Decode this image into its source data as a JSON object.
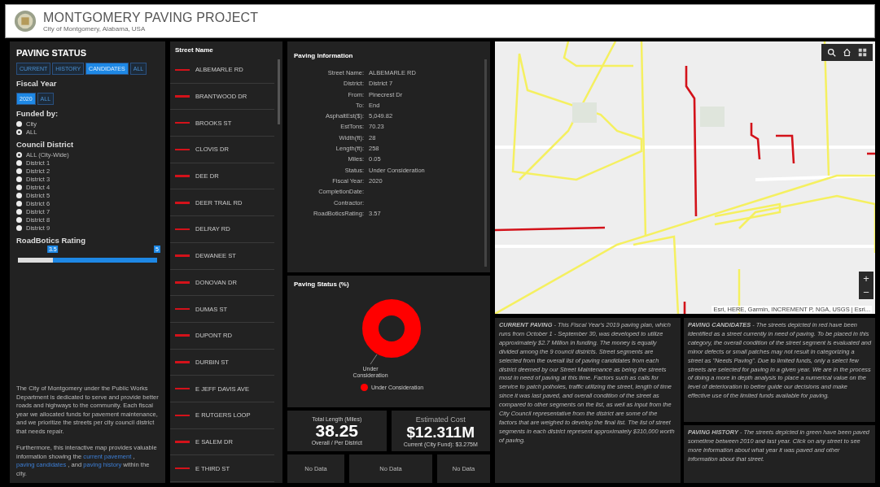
{
  "header": {
    "title": "MONTGOMERY PAVING PROJECT",
    "subtitle": "City of Montgomery, Alabama, USA"
  },
  "paving_status": {
    "title": "PAVING STATUS",
    "tabs": [
      {
        "label": "CURRENT",
        "selected": false
      },
      {
        "label": "HISTORY",
        "selected": false
      },
      {
        "label": "CANDIDATES",
        "selected": true
      },
      {
        "label": "ALL",
        "selected": false
      }
    ],
    "fiscal_year": {
      "label": "Fiscal Year",
      "options": [
        {
          "label": "2020",
          "selected": true
        },
        {
          "label": "ALL",
          "selected": false
        }
      ]
    },
    "funded_by": {
      "label": "Funded by:",
      "options": [
        {
          "label": "City",
          "selected": false
        },
        {
          "label": "ALL",
          "selected": true
        }
      ]
    },
    "council_district": {
      "label": "Council District",
      "options": [
        {
          "label": "ALL (City-Wide)",
          "selected": true
        },
        {
          "label": "District 1",
          "selected": false
        },
        {
          "label": "District 2",
          "selected": false
        },
        {
          "label": "District 3",
          "selected": false
        },
        {
          "label": "District 4",
          "selected": false
        },
        {
          "label": "District 5",
          "selected": false
        },
        {
          "label": "District 6",
          "selected": false
        },
        {
          "label": "District 7",
          "selected": false
        },
        {
          "label": "District 8",
          "selected": false
        },
        {
          "label": "District 9",
          "selected": false
        }
      ]
    },
    "rating": {
      "label": "RoadBotics Rating",
      "low_label": "3.5",
      "high_label": "5",
      "level": 0.75
    },
    "intro": "The City of Montgomery under the Public Works Department is dedicated to serve and provide better roads and highways to the community. Each fiscal year we allocated funds for pavement maintenance, and we prioritize the streets per city council district that needs repair.",
    "more": [
      {
        "kind": "text",
        "text": "Furthermore, this interactive map provides valuable information showing the"
      },
      {
        "kind": "link",
        "text": "current pavement"
      },
      {
        "kind": "text",
        "text": ","
      },
      {
        "kind": "link",
        "text": "paving candidates"
      },
      {
        "kind": "text",
        "text": ", and"
      },
      {
        "kind": "link",
        "text": "paving history"
      },
      {
        "kind": "text",
        "text": "within the city."
      }
    ]
  },
  "street_list": {
    "title": "Street Name",
    "items": [
      "ALBEMARLE RD",
      "BRANTWOOD DR",
      "BROOKS ST",
      "CLOVIS DR",
      "DEE DR",
      "DEER TRAIL RD",
      "DELRAY RD",
      "DEWANEE ST",
      "DONOVAN DR",
      "DUMAS ST",
      "DUPONT RD",
      "DURBIN ST",
      "E JEFF DAVIS AVE",
      "E RUTGERS LOOP",
      "E SALEM DR",
      "E THIRD ST"
    ]
  },
  "paving_information": {
    "title": "Paving Information",
    "fields": [
      {
        "label": "Street Name:",
        "value": "ALBEMARLE RD"
      },
      {
        "label": "District:",
        "value": "District 7"
      },
      {
        "label": "From:",
        "value": "Pinecrest Dr"
      },
      {
        "label": "To:",
        "value": "End"
      },
      {
        "label": "AsphaltEst($):",
        "value": "5,049.82"
      },
      {
        "label": "EstTons:",
        "value": "70.23"
      },
      {
        "label": "Width(ft):",
        "value": "28"
      },
      {
        "label": "Length(ft):",
        "value": "258"
      },
      {
        "label": "Miles:",
        "value": "0.05"
      },
      {
        "label": "Status:",
        "value": "Under Consideration"
      },
      {
        "label": "Fiscal Year:",
        "value": "2020"
      },
      {
        "label": "CompletionDate:"
      },
      {
        "label": "Contractor:"
      },
      {
        "label": "RoadBoticsRating:",
        "value": "3.57"
      }
    ]
  },
  "paving_status_chart": {
    "title": "Paving Status (%)",
    "slice_label": "Under Consideration",
    "legend": "Under Consideration"
  },
  "total_length": {
    "label": "Total Length (Miles)",
    "value": "38.25",
    "caption": "Overall / Per District"
  },
  "estimated_cost": {
    "label": "Estimated Cost",
    "value": "$12.311M",
    "caption": "Current (City Fund): $3.275M"
  },
  "no_data": [
    "No Data",
    "No Data",
    "No Data"
  ],
  "map": {
    "zoom_in": "+",
    "zoom_out": "−",
    "attribution": "Esri, HERE, Garmin, INCREMENT P, NGA, USGS | Esri..."
  },
  "descriptions": [
    {
      "text": "**CURRENT PAVING** - This Fiscal Year's 2019 paving plan, which runs from October 1 - September 30, was developed to utilize approximately $2.7 Million in funding. The money is equally divided among the 9 council districts. Street segments are selected from the overall list of paving candidates from each district deemed by our Street Maintenance as being the streets most in need of paving at this time. Factors such as calls for service to patch potholes, traffic utilizing the street, length of time since it was last paved, and overall condition of the street as compared to other segments on the list, as well as input from the City Council representative from the district are some of the factors that are weighed to develop the final list. The list of street segments in each district represent approximately $310,000 worth of paving."
    },
    {
      "text": "**PAVING CANDIDATES** - The streets depicted in red have been identified as a street currently in need of paving. To be placed in this category, the overall condition of the street segment is evaluated and minor defects or small patches may not result in categorizing a street as \"Needs Paving\". Due to limited funds, only a select few streets are selected for paving in a given year. We are in the process of doing a more in depth analysis to place a numerical value on the level of deterioration to better guide our decisions and make effective use of the limited funds available for paving."
    },
    {
      "text": "**PAVING HISTORY** - The streets depicted in green have been paved sometime between 2010 and last year. Click on any street to see more information about what year it was paved and other information about that street."
    }
  ]
}
